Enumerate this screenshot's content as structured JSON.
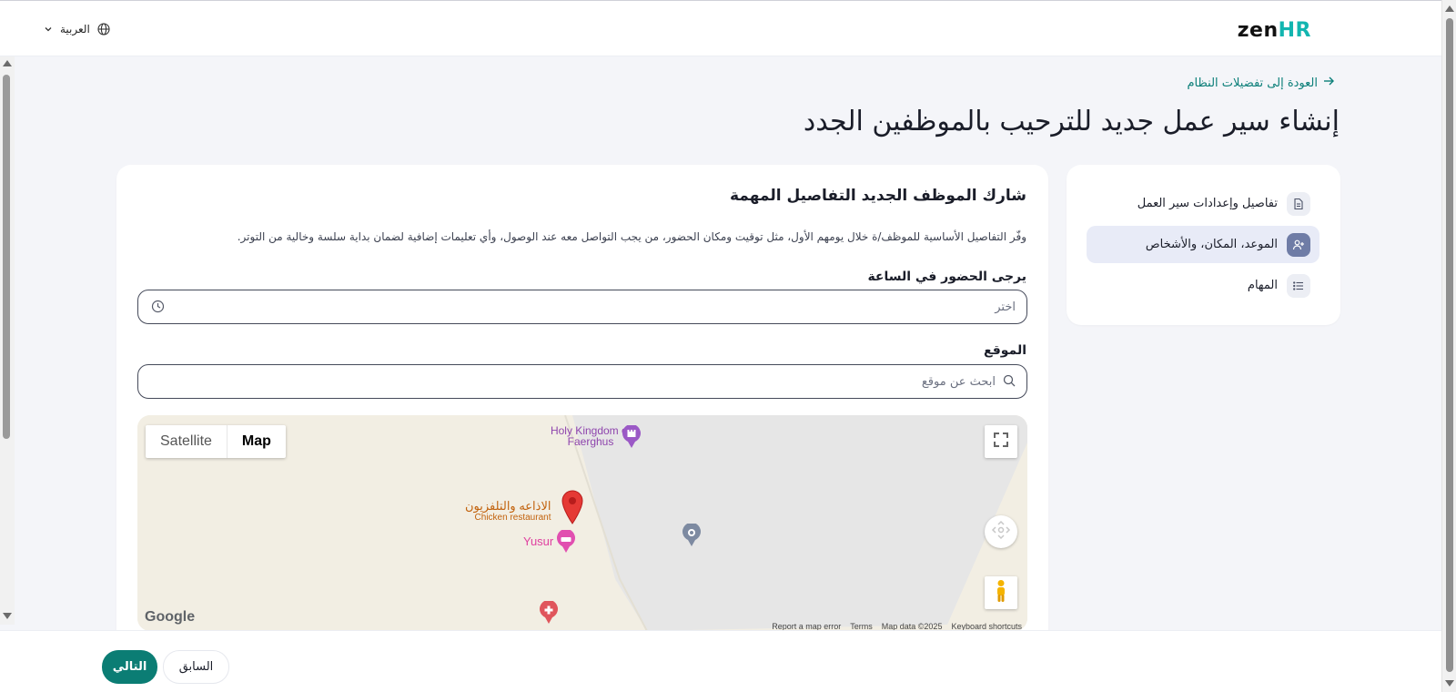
{
  "header": {
    "logo_main": "zen",
    "logo_accent": "HR",
    "language_label": "العربية"
  },
  "back_link": "العودة إلى تفضيلات النظام",
  "page_title": "إنشاء سير عمل جديد للترحيب بالموظفين الجدد",
  "steps": [
    {
      "label": "تفاصيل وإعدادات سير العمل",
      "icon": "document-icon",
      "active": false
    },
    {
      "label": "الموعد، المكان، والأشخاص",
      "icon": "add-user-icon",
      "active": true
    },
    {
      "label": "المهام",
      "icon": "list-icon",
      "active": false
    }
  ],
  "section": {
    "title": "شارك الموظف الجديد التفاصيل المهمة",
    "description": "وفّر التفاصيل الأساسية للموظف/ة خلال يومهم الأول، مثل توقيت ومكان الحضور، من يجب التواصل معه عند الوصول، وأي تعليمات إضافية لضمان بداية سلسة وخالية من التوتر."
  },
  "fields": {
    "arrival_time": {
      "label": "يرجى الحضور في الساعة",
      "placeholder": "اختر",
      "value": ""
    },
    "location": {
      "label": "الموقع",
      "placeholder": "ابحث عن موقع",
      "value": ""
    }
  },
  "map": {
    "type_options": [
      "Satellite",
      "Map"
    ],
    "selected_type": "Map",
    "pois": [
      {
        "name": "Holy Kingdom of Faerghus"
      },
      {
        "name": "الاذاعه والتلفزيون",
        "subtitle": "Chicken restaurant"
      },
      {
        "name": "Yusur"
      }
    ],
    "attribution": "Google",
    "footer": [
      "Report a map error",
      "Terms",
      "Map data ©2025",
      "Keyboard shortcuts"
    ]
  },
  "footer_buttons": {
    "next": "التالي",
    "previous": "السابق"
  },
  "colors": {
    "primary": "#0b7d74",
    "link": "#0a7e78",
    "active_step_bg": "#e8ebf7",
    "map_land": "#f2eee3",
    "marker_red": "#e53935",
    "poi_purple": "#8e44ad",
    "poi_pink": "#e040a0",
    "poi_orange": "#c2620d"
  }
}
